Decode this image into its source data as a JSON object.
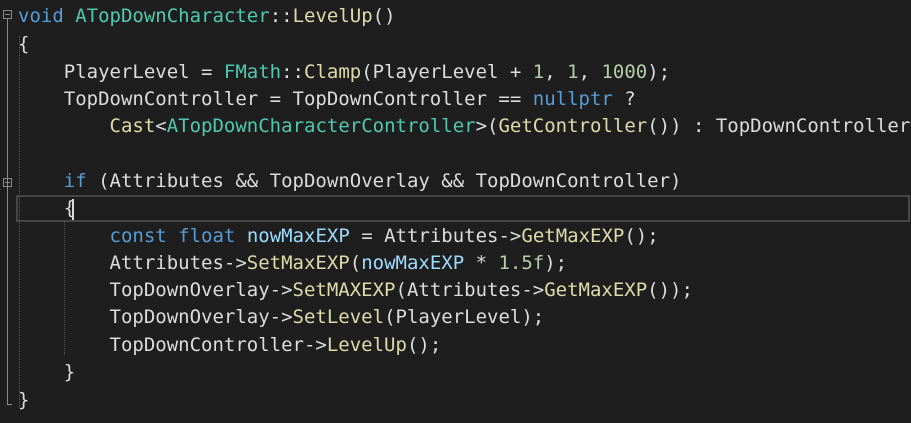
{
  "code": {
    "line1": {
      "t1": "void",
      "t2": " ",
      "t3": "ATopDownCharacter",
      "t4": "::",
      "t5": "LevelUp",
      "t6": "()"
    },
    "line2": {
      "t1": "{"
    },
    "line3": {
      "t1": "    PlayerLevel = ",
      "t2": "FMath",
      "t3": "::",
      "t4": "Clamp",
      "t5": "(PlayerLevel + ",
      "t6": "1",
      "t7": ", ",
      "t8": "1",
      "t9": ", ",
      "t10": "1000",
      "t11": ");"
    },
    "line4": {
      "t1": "    TopDownController = TopDownController == ",
      "t2": "nullptr",
      "t3": " ?"
    },
    "line5": {
      "t1": "        ",
      "t2": "Cast",
      "t3": "<",
      "t4": "ATopDownCharacterController",
      "t5": ">(",
      "t6": "GetController",
      "t7": "()) : TopDownController;"
    },
    "line6": {
      "t1": ""
    },
    "line7": {
      "t1": "    ",
      "t2": "if",
      "t3": " (Attributes && TopDownOverlay && TopDownController)"
    },
    "line8": {
      "t1": "    {"
    },
    "line9": {
      "t1": "        ",
      "t2": "const",
      "t3": " ",
      "t4": "float",
      "t5": " ",
      "t6": "nowMaxEXP",
      "t7": " = Attributes->",
      "t8": "GetMaxEXP",
      "t9": "();"
    },
    "line10": {
      "t1": "        Attributes->",
      "t2": "SetMaxEXP",
      "t3": "(",
      "t4": "nowMaxEXP",
      "t5": " * ",
      "t6": "1.5f",
      "t7": ");"
    },
    "line11": {
      "t1": "        TopDownOverlay->",
      "t2": "SetMAXEXP",
      "t3": "(Attributes->",
      "t4": "GetMaxEXP",
      "t5": "());"
    },
    "line12": {
      "t1": "        TopDownOverlay->",
      "t2": "SetLevel",
      "t3": "(PlayerLevel);"
    },
    "line13": {
      "t1": "        TopDownController->",
      "t2": "LevelUp",
      "t3": "();"
    },
    "line14": {
      "t1": "    }"
    },
    "line15": {
      "t1": "}"
    }
  },
  "colors": {
    "background": "#1e1e1e",
    "keyword": "#569cd6",
    "type": "#4ec9b0",
    "function": "#dcdcaa",
    "variable": "#9cdcfe",
    "number": "#b5cea8",
    "plain": "#dcdcdc"
  },
  "icons": {
    "fold_1": "collapse-toggle-icon",
    "fold_2": "collapse-toggle-icon"
  }
}
